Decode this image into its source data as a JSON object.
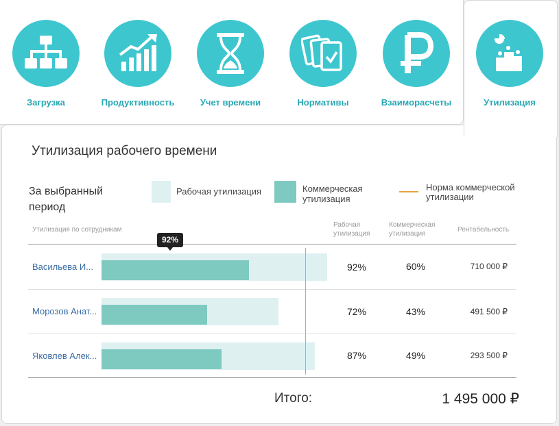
{
  "tabs": [
    {
      "label": "Загрузка",
      "icon": "hierarchy-icon"
    },
    {
      "label": "Продуктивность",
      "icon": "growth-chart-icon"
    },
    {
      "label": "Учет времени",
      "icon": "hourglass-icon"
    },
    {
      "label": "Нормативы",
      "icon": "cards-check-icon"
    },
    {
      "label": "Взаиморасчеты",
      "icon": "ruble-icon"
    },
    {
      "label": "Утилизация",
      "icon": "podium-icon"
    }
  ],
  "active_tab": "Утилизация",
  "title": "Утилизация рабочего времени",
  "period_label": "За выбранный период",
  "legend": {
    "work": "Рабочая утилизация",
    "commercial": "Коммерческая утилизация",
    "norm": "Норма коммерческой утилизации"
  },
  "table": {
    "col_employees": "Утилизация по сотрудникам",
    "col_work": "Рабочая утилизация",
    "col_commercial": "Коммерческая утилизация",
    "col_profit": "Рентабельность",
    "rows": [
      {
        "name": "Васильева И...",
        "work": "92%",
        "commercial": "60%",
        "profit": "710 000 ₽",
        "work_pct": 92,
        "comm_pct": 60
      },
      {
        "name": "Морозов Анат...",
        "work": "72%",
        "commercial": "43%",
        "profit": "491 500 ₽",
        "work_pct": 72,
        "comm_pct": 43
      },
      {
        "name": "Яковлев Алек...",
        "work": "87%",
        "commercial": "49%",
        "profit": "293 500 ₽",
        "work_pct": 87,
        "comm_pct": 49
      }
    ]
  },
  "tooltip": "92%",
  "total_label": "Итого:",
  "total_value": "1 495 000 ₽",
  "colors": {
    "accent": "#3ec6cf",
    "work_bar": "#dff0f1",
    "comm_bar": "#7ecac1",
    "norm_line": "#e8a33c",
    "link": "#3a6ea5"
  }
}
